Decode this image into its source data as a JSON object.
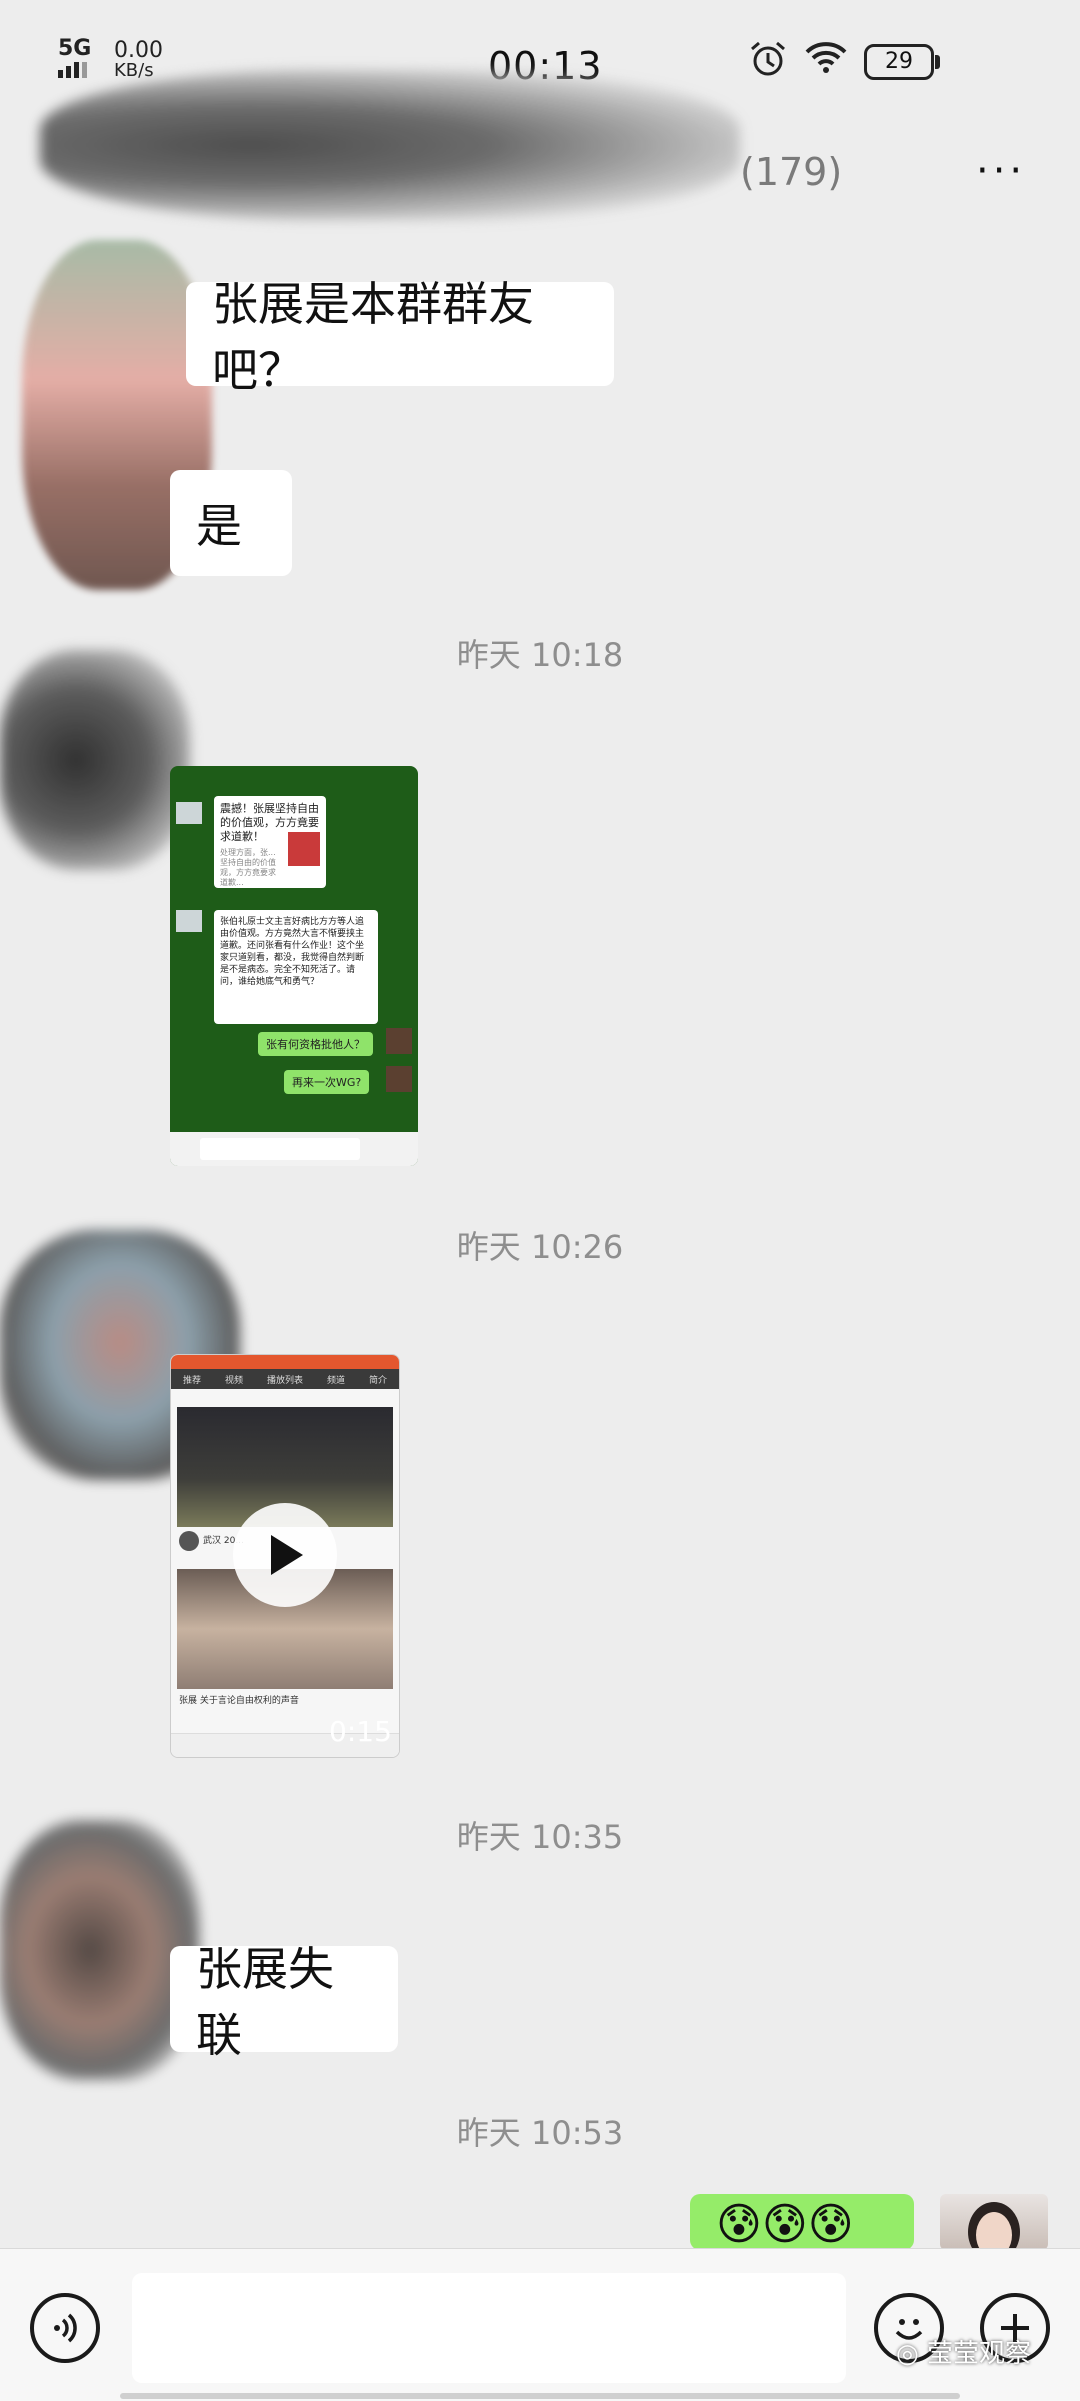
{
  "status_bar": {
    "network": "5G",
    "speed_value": "0.00",
    "speed_unit": "KB/s",
    "time": "00:13",
    "battery": "29"
  },
  "title_bar": {
    "member_count": "(179)",
    "more_label": "···"
  },
  "messages": [
    {
      "text": "张展是本群群友吧？"
    },
    {
      "text": "是"
    },
    {
      "timestamp": "昨天 10:18"
    },
    {
      "timestamp": "昨天 10:26"
    },
    {
      "video_duration": "0:15"
    },
    {
      "timestamp": "昨天 10:35"
    },
    {
      "text": "张展失联"
    },
    {
      "timestamp": "昨天 10:53"
    },
    {
      "emoji": "😰😰😰"
    }
  ],
  "embedded_chat": {
    "bubble1": "震撼！张展坚持自由的价值观，方方竟要求道歉！",
    "bubble1_sub": "处理方面，张...坚持自由的价值观，方方竟要求道歉...",
    "bubble2": "张伯礼原士文主言好病比方方等人追由价值观。方方竟然大言不惭要挟主道歉。还问张看有什么作业！这个坐家只道别看，都没，我觉得自然判断是不是病态。完全不知死活了。请问，谁给她底气和勇气？",
    "green1": "张有何资格批他人？",
    "green2": "再来一次WG?"
  },
  "embedded_video": {
    "tabs": [
      "推荐",
      "视频",
      "播放列表",
      "频道",
      "简介"
    ],
    "item1_title": "武汉 20...",
    "item2_title": "张展 关于言论自由权利的声音"
  },
  "input_bar": {
    "watermark": "莹莹观察"
  },
  "colors": {
    "background": "#ededed",
    "bubble_white": "#ffffff",
    "bubble_green": "#95ec69",
    "timestamp": "#8e8e8e"
  }
}
